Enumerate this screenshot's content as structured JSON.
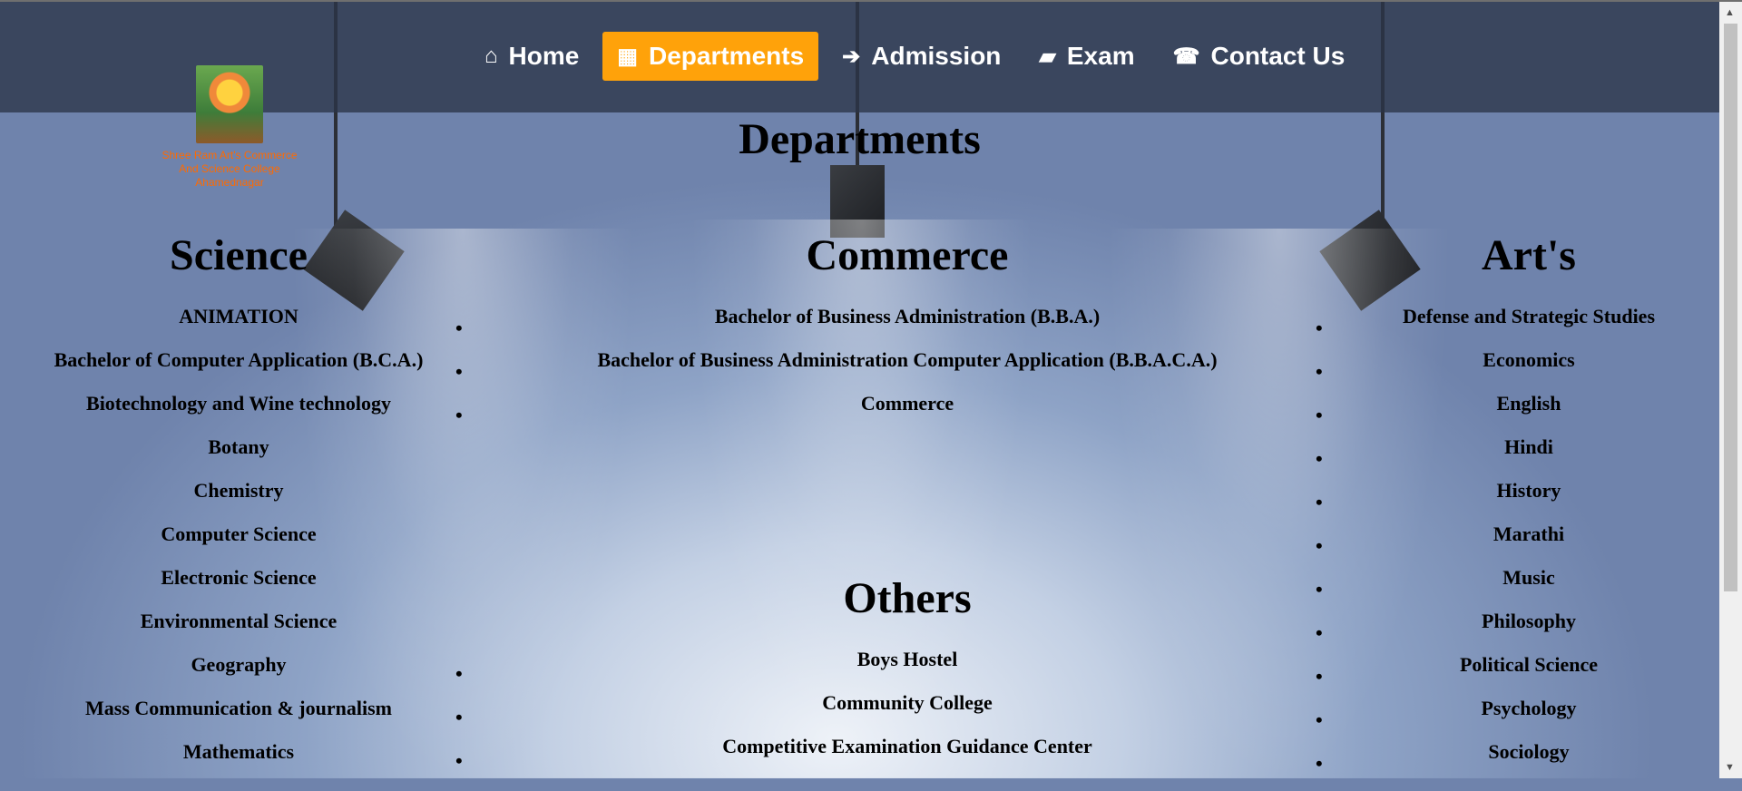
{
  "nav": {
    "items": [
      {
        "label": "Home",
        "icon": "home-icon",
        "glyph": "⌂"
      },
      {
        "label": "Departments",
        "icon": "building-icon",
        "glyph": "▦"
      },
      {
        "label": "Admission",
        "icon": "sign-in-icon",
        "glyph": "➔"
      },
      {
        "label": "Exam",
        "icon": "book-icon",
        "glyph": "▰"
      },
      {
        "label": "Contact Us",
        "icon": "phone-icon",
        "glyph": "☎"
      }
    ],
    "active_index": 1,
    "active_color": "#ffa20a"
  },
  "logo": {
    "text": "Shree Ram Art's Commerce And Science College Ahamednagar"
  },
  "page_title": "Departments",
  "science": {
    "heading": "Science",
    "items": [
      "ANIMATION",
      "Bachelor of Computer Application (B.C.A.)",
      "Biotechnology and Wine technology",
      "Botany",
      "Chemistry",
      "Computer Science",
      "Electronic Science",
      "Environmental Science",
      "Geography",
      "Mass Communication & journalism",
      "Mathematics"
    ]
  },
  "commerce": {
    "heading": "Commerce",
    "items": [
      "Bachelor of Business Administration (B.B.A.)",
      "Bachelor of Business Administration Computer Application (B.B.A.C.A.)",
      "Commerce"
    ]
  },
  "others": {
    "heading": "Others",
    "items": [
      "Boys Hostel",
      "Community College",
      "Competitive Examination Guidance Center"
    ]
  },
  "arts": {
    "heading": "Art's",
    "items": [
      "Defense and Strategic Studies",
      "Economics",
      "English",
      "Hindi",
      "History",
      "Marathi",
      "Music",
      "Philosophy",
      "Political Science",
      "Psychology",
      "Sociology"
    ]
  },
  "bullet_char": "•"
}
